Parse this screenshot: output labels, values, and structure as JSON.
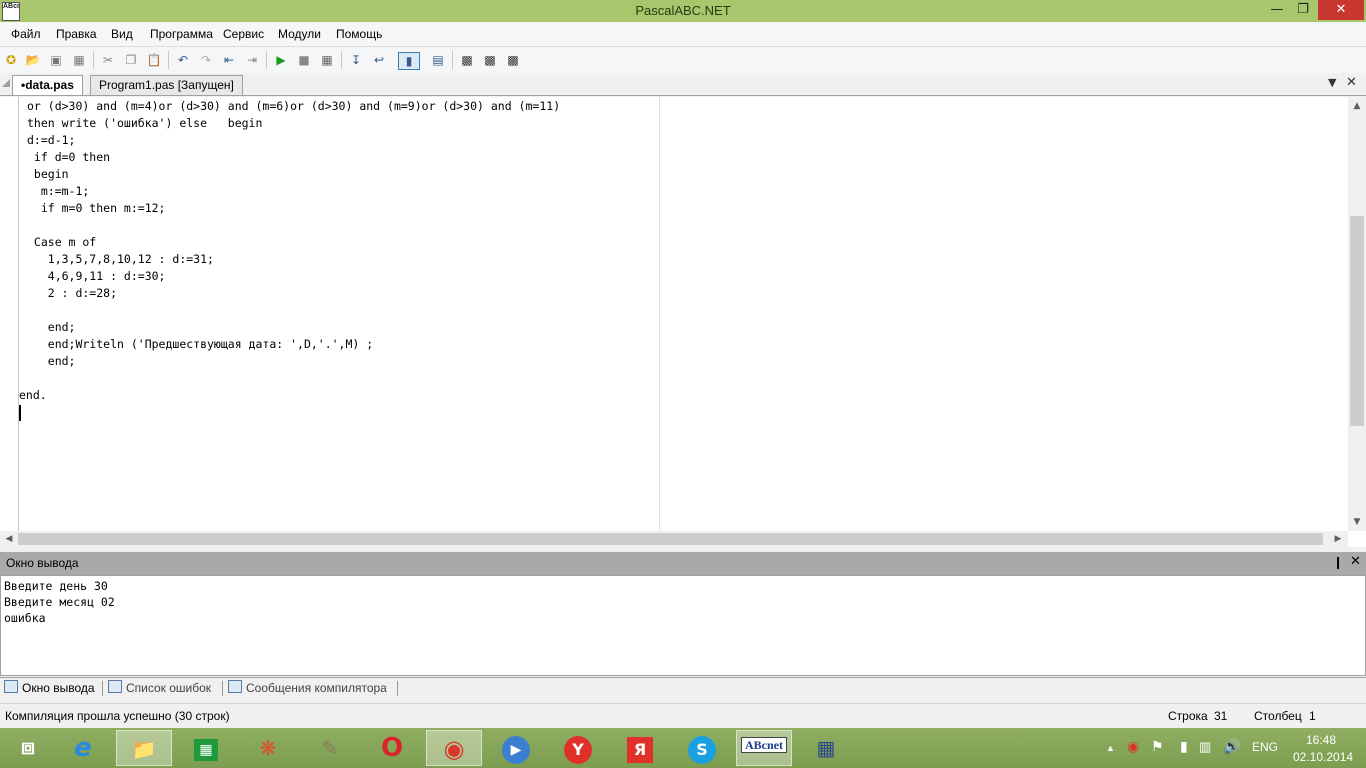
{
  "window": {
    "title": "PascalABC.NET",
    "icon_text": "ABсnet"
  },
  "menu": [
    "Файл",
    "Правка",
    "Вид",
    "Программа",
    "Сервис",
    "Модули",
    "Помощь"
  ],
  "tabs": [
    {
      "label": "•data.pas",
      "active": true
    },
    {
      "label": "Program1.pas [Запущен]",
      "active": false
    }
  ],
  "code_lines": [
    "or (d>30) and (m=4)or (d>30) and (m=6)or (d>30) and (m=9)or (d>30) and (m=11)",
    "then write ('ошибка') else   begin",
    "d:=d-1;",
    " if d=0 then",
    " begin",
    "  m:=m-1;",
    "  if m=0 then m:=12;",
    "",
    " Case m of",
    "   1,3,5,7,8,10,12 : d:=31;",
    "   4,6,9,11 : d:=30;",
    "   2 : d:=28;",
    "",
    "   end;",
    "   end;Writeln ('Предшествующая дата: ',D,'.',M) ;",
    "   end;",
    "",
    "end."
  ],
  "output_pane": {
    "title": "Окно вывода",
    "lines": [
      "Введите день 30",
      "Введите месяц 02",
      "ошибка"
    ]
  },
  "bottom_tabs": [
    "Окно вывода",
    "Список ошибок",
    "Сообщения компилятора"
  ],
  "status": {
    "message": "Компиляция прошла успешно (30 строк)",
    "row_label": "Строка",
    "row_value": "31",
    "col_label": "Столбец",
    "col_value": "1"
  },
  "taskbar": {
    "apps": [
      "windows-start",
      "internet-explorer",
      "file-explorer",
      "store",
      "picasa",
      "paint",
      "opera",
      "chrome",
      "sound",
      "yandex-browser",
      "yandex",
      "skype",
      "pascalabc",
      "app"
    ],
    "language": "ENG",
    "time": "16:48",
    "date": "02.10.2014"
  }
}
